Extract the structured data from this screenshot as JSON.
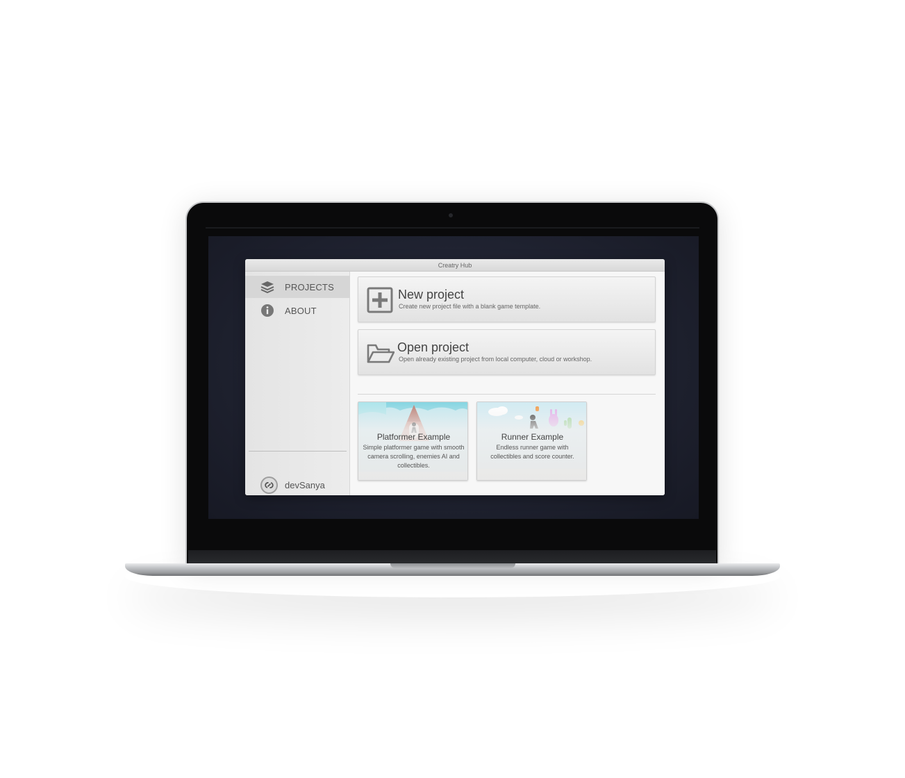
{
  "window": {
    "title": "Creatry Hub"
  },
  "sidebar": {
    "items": [
      {
        "label": "PROJECTS",
        "icon": "layers-icon",
        "active": true
      },
      {
        "label": "ABOUT",
        "icon": "info-icon",
        "active": false
      }
    ],
    "user": {
      "name": "devSanya",
      "icon": "link-avatar-icon"
    }
  },
  "main": {
    "actions": [
      {
        "title": "New project",
        "description": "Create new project file with a blank game template.",
        "icon": "plus-box-icon"
      },
      {
        "title": "Open project",
        "description": "Open already existing project from local computer, cloud or workshop.",
        "icon": "folder-open-icon"
      }
    ],
    "examples": [
      {
        "title": "Platformer Example",
        "description": "Simple platformer game with smooth camera scrolling, enemies AI and collectibles."
      },
      {
        "title": "Runner Example",
        "description": "Endless runner game with collectibles and score counter."
      }
    ]
  },
  "colors": {
    "screen_background": "#1f2230",
    "window_background": "#f6f6f6",
    "sidebar_background": "#e8e8e8",
    "text": "#555555"
  }
}
